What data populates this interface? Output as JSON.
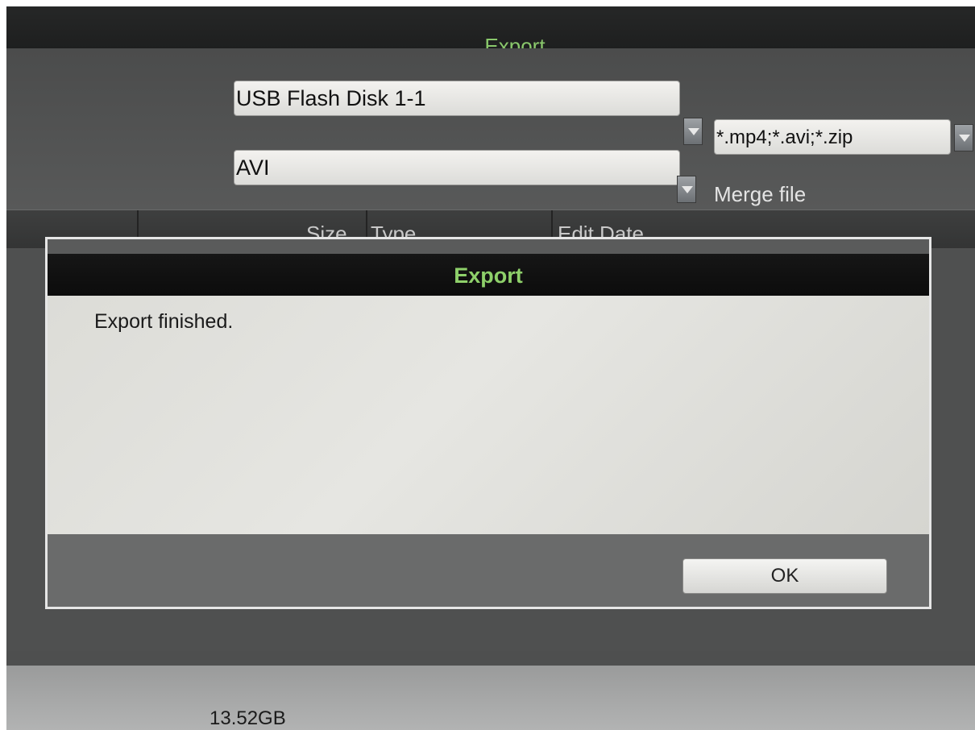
{
  "window": {
    "title": "Export"
  },
  "export_form": {
    "device_select": {
      "value": "USB Flash Disk 1-1"
    },
    "file_type_select": {
      "value": "*.mp4;*.avi;*.zip"
    },
    "format_select": {
      "value": "AVI"
    },
    "merge_label": "Merge file"
  },
  "file_table": {
    "columns": [
      "Size",
      "Type",
      "Edit Date"
    ]
  },
  "footer": {
    "disk_size": "13.52GB"
  },
  "dialog": {
    "title": "Export",
    "message": "Export finished.",
    "ok_label": "OK"
  },
  "colors": {
    "title_green": "#8ac86c",
    "dialog_title_green": "#8ed06a"
  }
}
